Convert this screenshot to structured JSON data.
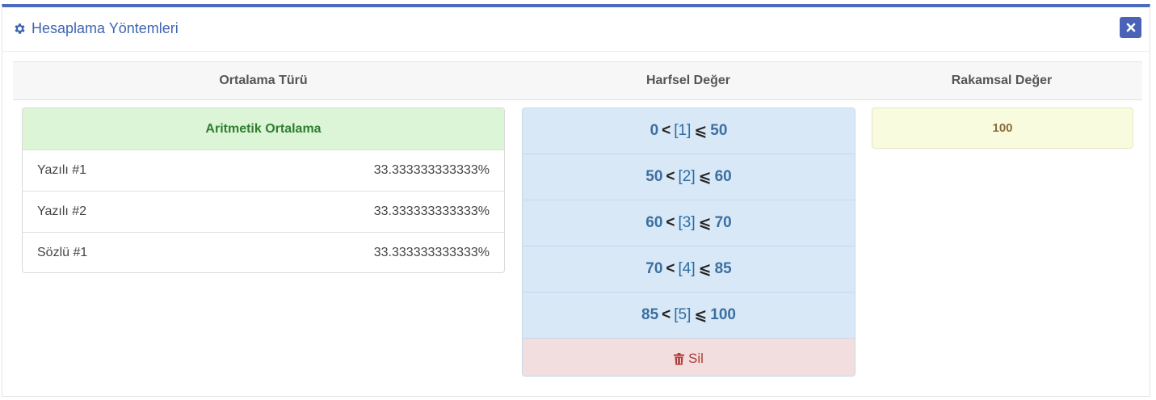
{
  "panel": {
    "title": "Hesaplama Yöntemleri",
    "icons": {
      "title_icon": "gear-icon",
      "close_icon": "close-icon"
    },
    "accent_color": "#4a6cbc"
  },
  "columns": {
    "average_type": "Ortalama Türü",
    "letter_value": "Harfsel Değer",
    "numeric_value": "Rakamsal Değer"
  },
  "average": {
    "name": "Aritmetik Ortalama",
    "items": [
      {
        "label": "Yazılı #1",
        "weight": "33.333333333333%"
      },
      {
        "label": "Yazılı #2",
        "weight": "33.333333333333%"
      },
      {
        "label": "Sözlü #1",
        "weight": "33.333333333333%"
      }
    ]
  },
  "grades": [
    {
      "low": "0",
      "lt": "<",
      "grade": "[1]",
      "le": "⩽",
      "high": "50"
    },
    {
      "low": "50",
      "lt": "<",
      "grade": "[2]",
      "le": "⩽",
      "high": "60"
    },
    {
      "low": "60",
      "lt": "<",
      "grade": "[3]",
      "le": "⩽",
      "high": "70"
    },
    {
      "low": "70",
      "lt": "<",
      "grade": "[4]",
      "le": "⩽",
      "high": "85"
    },
    {
      "low": "85",
      "lt": "<",
      "grade": "[5]",
      "le": "⩽",
      "high": "100"
    }
  ],
  "delete_label": "Sil",
  "numeric_value": "100"
}
